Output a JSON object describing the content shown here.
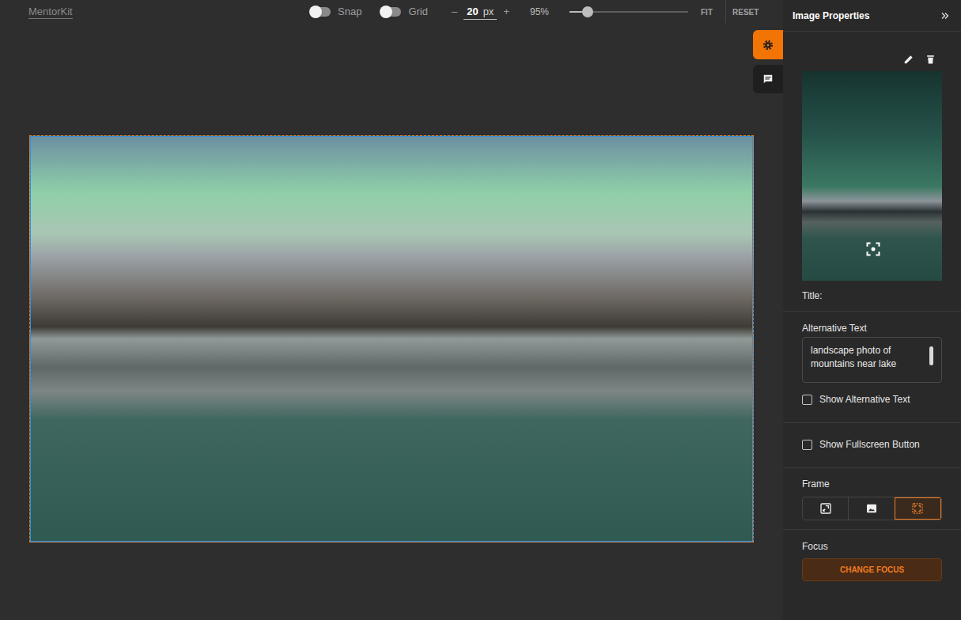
{
  "app": {
    "logo": "MentorKit"
  },
  "toolbar": {
    "toggles": [
      {
        "label": "Snap",
        "on": false
      },
      {
        "label": "Grid",
        "on": false
      }
    ],
    "size": {
      "minus": "–",
      "value": "20",
      "unit": "px",
      "plus": "+"
    },
    "zoom": {
      "reading": "95%",
      "level": 0.15
    },
    "buttons": [
      "FIT",
      "RESET"
    ]
  },
  "side_tabs": [
    {
      "kind": "settings",
      "selected": true
    },
    {
      "kind": "comments",
      "selected": false
    }
  ],
  "canvas": {
    "image": {
      "selected": true
    }
  },
  "panel": {
    "title": "Image Properties",
    "title_label": "Title:",
    "alt_text": {
      "label": "Alternative Text",
      "value": "landscape photo of mountains near lake"
    },
    "checkboxes": [
      {
        "label": "Show Alternative Text",
        "checked": false
      },
      {
        "label": "Show Fullscreen Button",
        "checked": false
      }
    ],
    "frame": {
      "label": "Frame",
      "options": [
        {
          "kind": "fit",
          "selected": false
        },
        {
          "kind": "image",
          "selected": false
        },
        {
          "kind": "fill",
          "selected": true
        }
      ]
    },
    "focus": {
      "label": "Focus",
      "button": "CHANGE FOCUS"
    }
  }
}
